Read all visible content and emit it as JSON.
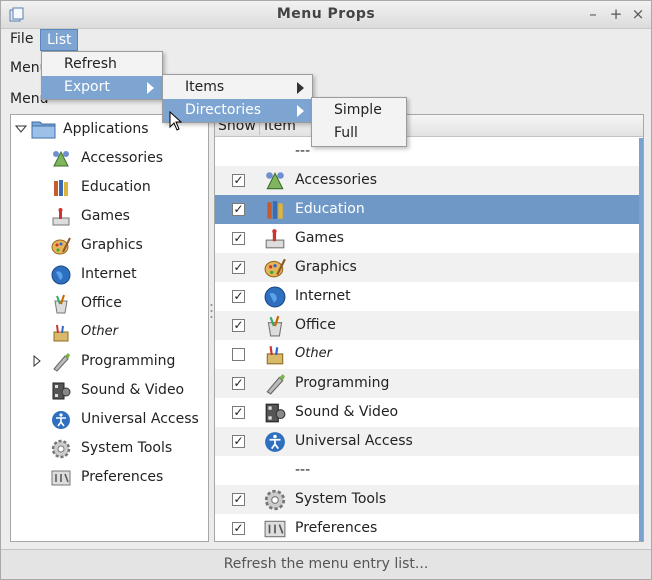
{
  "window": {
    "title": "Menu Props",
    "controls": [
      "–",
      "+",
      "×"
    ]
  },
  "menubar": {
    "file": "File",
    "list": "List"
  },
  "list_menu": {
    "refresh": "Refresh",
    "export": "Export"
  },
  "export_menu": {
    "items": "Items",
    "directories": "Directories"
  },
  "directories_menu": {
    "simple": "Simple",
    "full": "Full"
  },
  "behind_labels": {
    "upper": "Menu",
    "lower": "Menu"
  },
  "tree": {
    "root": "Applications",
    "items": [
      {
        "label": "Accessories",
        "icon": "accessories-icon"
      },
      {
        "label": "Education",
        "icon": "education-icon"
      },
      {
        "label": "Games",
        "icon": "games-icon"
      },
      {
        "label": "Graphics",
        "icon": "graphics-icon"
      },
      {
        "label": "Internet",
        "icon": "internet-icon"
      },
      {
        "label": "Office",
        "icon": "office-icon"
      },
      {
        "label": "Other",
        "icon": "other-icon"
      },
      {
        "label": "Programming",
        "icon": "programming-icon"
      },
      {
        "label": "Sound & Video",
        "icon": "sound-video-icon"
      },
      {
        "label": "Universal Access",
        "icon": "universal-access-icon"
      },
      {
        "label": "System Tools",
        "icon": "system-tools-icon"
      },
      {
        "label": "Preferences",
        "icon": "preferences-icon"
      }
    ]
  },
  "table": {
    "headers": {
      "show": "Show",
      "item": "Item"
    },
    "separator": "---",
    "rows": [
      {
        "label": "Accessories",
        "checked": true
      },
      {
        "label": "Education",
        "checked": true,
        "selected": true
      },
      {
        "label": "Games",
        "checked": true
      },
      {
        "label": "Graphics",
        "checked": true
      },
      {
        "label": "Internet",
        "checked": true
      },
      {
        "label": "Office",
        "checked": true
      },
      {
        "label": "Other",
        "checked": false
      },
      {
        "label": "Programming",
        "checked": true
      },
      {
        "label": "Sound & Video",
        "checked": true
      },
      {
        "label": "Universal Access",
        "checked": true
      },
      {
        "label": "System Tools",
        "checked": true
      },
      {
        "label": "Preferences",
        "checked": true
      }
    ]
  },
  "status": "Refresh the menu entry list...",
  "colors": {
    "highlight": "#7ea5d2",
    "selection": "#6f98c7"
  }
}
